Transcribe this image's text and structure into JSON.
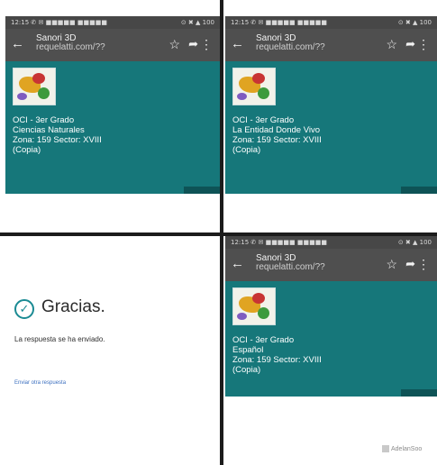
{
  "status": {
    "left": "12:15 ✆ ✉ ■■■■■ ■■■■■",
    "right": "⊙ ✖ ▲ 100"
  },
  "browser": {
    "tab_title": "Sanori 3D",
    "url": "requelatti.com/??",
    "back_icon": "arrow-left-icon",
    "star_icon": "star-icon",
    "share_icon": "share-icon",
    "more_icon": "more-vert-icon"
  },
  "colors": {
    "banner": "#16777a",
    "toolbar": "#4f4f4f",
    "statusbar": "#474747",
    "accent": "#1a8a93",
    "divider": "#1c1c1c"
  },
  "cards": [
    {
      "grade": "OCI - 3er Grado",
      "subject": "Ciencias Naturales",
      "zone": "Zona: 159   Sector: XVIII",
      "copia": "(Copia)"
    },
    {
      "grade": "OCI - 3er Grado",
      "subject": "La Entidad Donde Vivo",
      "zone": "Zona: 159   Sector: XVIII",
      "copia": "(Copia)"
    },
    {
      "grade": "OCI - 3er Grado",
      "subject": "Español",
      "zone": "Zona: 159   Sector: XVIII",
      "copia": "(Copia)"
    }
  ],
  "confirmation": {
    "title": "Gracias.",
    "message": "La respuesta se ha enviado.",
    "link": "Enviar otra respuesta"
  },
  "watermark": "AdelanSoo"
}
